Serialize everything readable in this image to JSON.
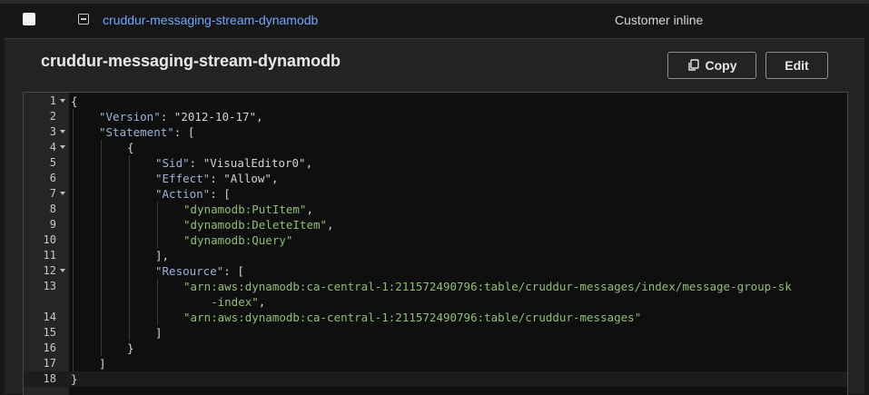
{
  "row": {
    "policy_name": "cruddur-messaging-stream-dynamodb",
    "policy_type": "Customer inline"
  },
  "panel": {
    "title": "cruddur-messaging-stream-dynamodb",
    "copy_label": "Copy",
    "edit_label": "Edit"
  },
  "editor": {
    "lines": [
      {
        "num": "1",
        "fold": true,
        "indent": 0,
        "code": "{"
      },
      {
        "num": "2",
        "fold": false,
        "indent": 1,
        "code": "\"Version\": \"2012-10-17\","
      },
      {
        "num": "3",
        "fold": true,
        "indent": 1,
        "code": "\"Statement\": ["
      },
      {
        "num": "4",
        "fold": true,
        "indent": 2,
        "code": "{"
      },
      {
        "num": "5",
        "fold": false,
        "indent": 3,
        "code": "\"Sid\": \"VisualEditor0\","
      },
      {
        "num": "6",
        "fold": false,
        "indent": 3,
        "code": "\"Effect\": \"Allow\","
      },
      {
        "num": "7",
        "fold": true,
        "indent": 3,
        "code": "\"Action\": ["
      },
      {
        "num": "8",
        "fold": false,
        "indent": 4,
        "code": "\"dynamodb:PutItem\","
      },
      {
        "num": "9",
        "fold": false,
        "indent": 4,
        "code": "\"dynamodb:DeleteItem\","
      },
      {
        "num": "10",
        "fold": false,
        "indent": 4,
        "code": "\"dynamodb:Query\""
      },
      {
        "num": "11",
        "fold": false,
        "indent": 3,
        "code": "],"
      },
      {
        "num": "12",
        "fold": true,
        "indent": 3,
        "code": "\"Resource\": ["
      },
      {
        "num": "13",
        "fold": false,
        "indent": 4,
        "code": "\"arn:aws:dynamodb:ca-central-1:211572490796:table/cruddur-messages/index/message-group-sk"
      },
      {
        "num": "",
        "fold": false,
        "indent": 4,
        "code": "    -index\","
      },
      {
        "num": "14",
        "fold": false,
        "indent": 4,
        "code": "\"arn:aws:dynamodb:ca-central-1:211572490796:table/cruddur-messages\""
      },
      {
        "num": "15",
        "fold": false,
        "indent": 3,
        "code": "]"
      },
      {
        "num": "16",
        "fold": false,
        "indent": 2,
        "code": "}"
      },
      {
        "num": "17",
        "fold": false,
        "indent": 1,
        "code": "]"
      },
      {
        "num": "18",
        "fold": false,
        "indent": 0,
        "code": "}"
      }
    ]
  }
}
